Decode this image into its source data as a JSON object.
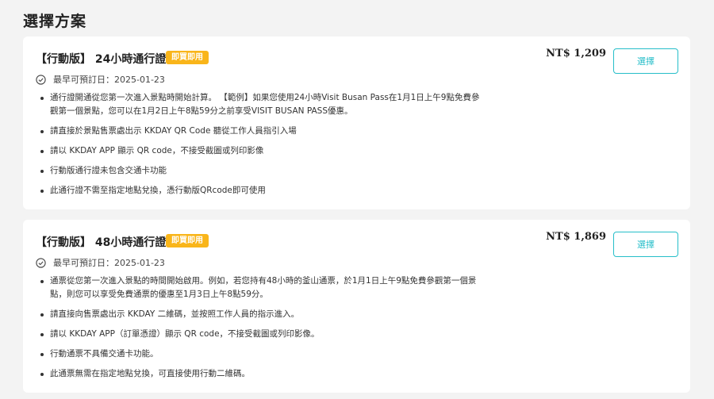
{
  "page": {
    "title": "選擇方案"
  },
  "colors": {
    "accent": "#26bec9",
    "badge": "#f9b51a",
    "background": "#f3f3f3",
    "card": "#ffffff"
  },
  "icons": {
    "date": "check-circle-icon"
  },
  "plans": [
    {
      "title": "【行動版】 24小時通行證",
      "badge": "即買即用",
      "date": "最早可預訂日：2025-01-23",
      "price": "NT$ 1,209",
      "button": "選擇",
      "bullets": [
        "通行證開通從您第一次進入景點時開始計算。 【範例】如果您使用24小時Visit Busan Pass在1月1日上午9點免費參觀第一個景點，您可以在1月2日上午8點59分之前享受VISIT BUSAN PASS優惠。",
        "請直接於景點售票處出示 KKDAY QR Code 聽從工作人員指引入場",
        "請以 KKDAY APP 顯示 QR code，不接受截圖或列印影像",
        "行動版通行證未包含交通卡功能",
        "此通行證不需至指定地點兌換，憑行動版QRcode即可使用"
      ]
    },
    {
      "title": "【行動版】 48小時通行證",
      "badge": "即買即用",
      "date": "最早可預訂日：2025-01-23",
      "price": "NT$ 1,869",
      "button": "選擇",
      "bullets": [
        "通票從您第一次進入景點的時間開始啟用。例如，若您持有48小時的釜山通票，於1月1日上午9點免費參觀第一個景點，則您可以享受免費通票的優惠至1月3日上午8點59分。",
        "請直接向售票處出示 KKDAY 二維碼，並按照工作人員的指示進入。",
        "請以 KKDAY APP（訂單憑證）顯示 QR code，不接受截圖或列印影像。",
        "行動通票不具備交通卡功能。",
        "此通票無需在指定地點兌換，可直接使用行動二維碼。"
      ]
    }
  ]
}
